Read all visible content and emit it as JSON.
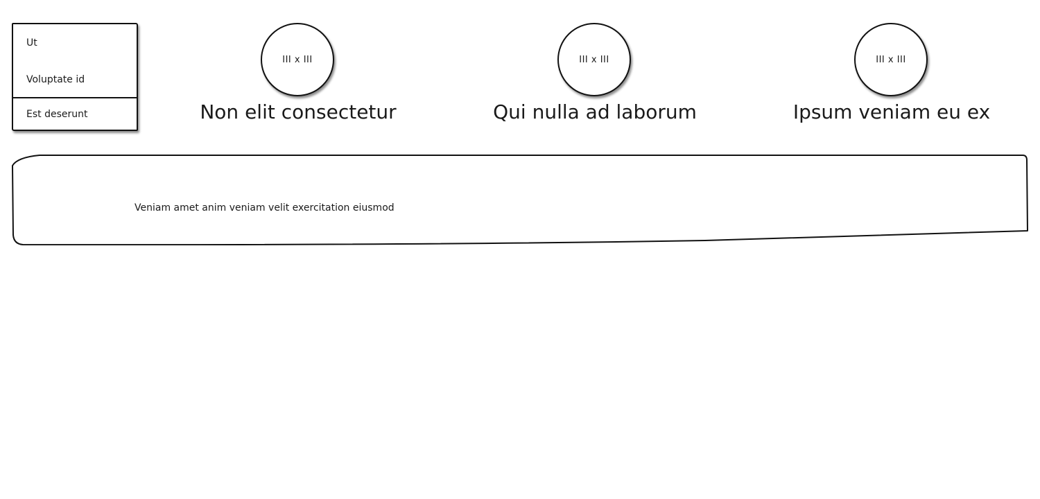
{
  "menu": {
    "items": [
      {
        "label": "Ut"
      },
      {
        "label": "Voluptate id"
      },
      {
        "label": "Est deserunt"
      }
    ]
  },
  "profiles": [
    {
      "avatar_text": "III x III",
      "name": "Non elit consectetur"
    },
    {
      "avatar_text": "III x III",
      "name": "Qui nulla ad laborum"
    },
    {
      "avatar_text": "III x III",
      "name": "Ipsum veniam eu ex"
    }
  ],
  "panel": {
    "text": "Veniam amet anim veniam velit exercitation eiusmod"
  },
  "colors": {
    "stroke": "#111111",
    "background": "#ffffff",
    "text": "#1a1a1a"
  }
}
